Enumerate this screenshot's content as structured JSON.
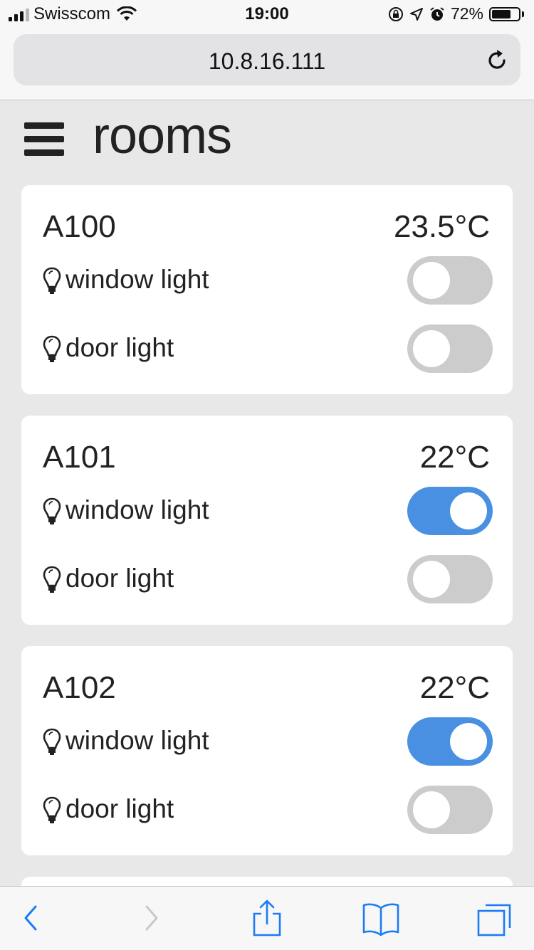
{
  "status_bar": {
    "carrier": "Swisscom",
    "time": "19:00",
    "battery_percent": "72%",
    "battery_level": 0.72,
    "icons": [
      "signal-icon",
      "wifi-icon",
      "orientation-lock-icon",
      "location-icon",
      "alarm-icon",
      "battery-icon"
    ]
  },
  "browser": {
    "url": "10.8.16.111",
    "reload_icon": "reload-icon"
  },
  "page": {
    "menu_icon": "hamburger-icon",
    "title": "rooms"
  },
  "colors": {
    "toggle_on": "#4a90e2",
    "toggle_off": "#cccccc",
    "background": "#e8e8e8",
    "card": "#ffffff",
    "toolbar_tint": "#1a7cf5"
  },
  "rooms": [
    {
      "name": "A100",
      "temperature": "23.5°C",
      "lights": [
        {
          "label": "window light",
          "icon": "lightbulb-icon",
          "on": false
        },
        {
          "label": "door light",
          "icon": "lightbulb-icon",
          "on": false
        }
      ]
    },
    {
      "name": "A101",
      "temperature": "22°C",
      "lights": [
        {
          "label": "window light",
          "icon": "lightbulb-icon",
          "on": true
        },
        {
          "label": "door light",
          "icon": "lightbulb-icon",
          "on": false
        }
      ]
    },
    {
      "name": "A102",
      "temperature": "22°C",
      "lights": [
        {
          "label": "window light",
          "icon": "lightbulb-icon",
          "on": true
        },
        {
          "label": "door light",
          "icon": "lightbulb-icon",
          "on": false
        }
      ]
    }
  ],
  "toolbar": {
    "buttons": [
      {
        "icon": "back-icon",
        "enabled": true
      },
      {
        "icon": "forward-icon",
        "enabled": false
      },
      {
        "icon": "share-icon",
        "enabled": true
      },
      {
        "icon": "bookmarks-icon",
        "enabled": true
      },
      {
        "icon": "tabs-icon",
        "enabled": true
      }
    ]
  }
}
